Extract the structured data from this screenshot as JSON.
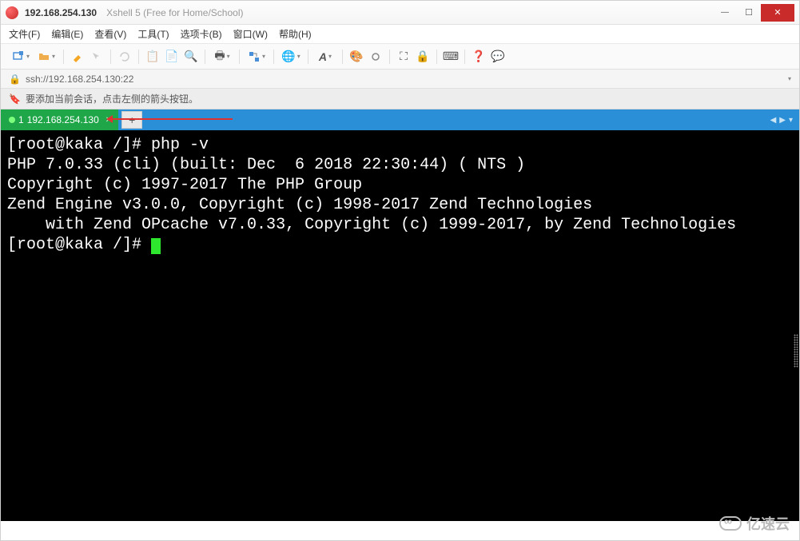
{
  "titlebar": {
    "host": "192.168.254.130",
    "app": "Xshell 5 (Free for Home/School)"
  },
  "menu": {
    "file": "文件(F)",
    "edit": "编辑(E)",
    "view": "查看(V)",
    "tools": "工具(T)",
    "tabs": "选项卡(B)",
    "window": "窗口(W)",
    "help": "帮助(H)"
  },
  "toolbar": {
    "icons": {
      "new": "new-tab-icon",
      "open": "folder-open-icon",
      "highlight": "highlighter-icon",
      "cursor": "arrow-icon",
      "copy": "copy-icon",
      "paste": "paste-icon",
      "search": "search-icon",
      "print": "print-icon",
      "transfer": "file-transfer-icon",
      "globe": "globe-icon",
      "font": "font-icon",
      "color": "palette-icon",
      "session": "session-icon",
      "fullscreen": "fullscreen-icon",
      "lock": "lock-icon",
      "keyboard": "keyboard-icon",
      "help": "help-icon",
      "bubble": "bubble-icon"
    }
  },
  "addressbar": {
    "protocol_icon": "lock-icon",
    "url": "ssh://192.168.254.130:22"
  },
  "msgbar": {
    "icon": "bookmark-icon",
    "text": "要添加当前会话，点击左侧的箭头按钮。"
  },
  "tabs": {
    "active": {
      "index": "1",
      "label": "192.168.254.130"
    },
    "add": "+"
  },
  "terminal": {
    "prompt1": "[root@kaka /]# ",
    "cmd": "php -v",
    "lines": [
      "PHP 7.0.33 (cli) (built: Dec  6 2018 22:30:44) ( NTS )",
      "Copyright (c) 1997-2017 The PHP Group",
      "Zend Engine v3.0.0, Copyright (c) 1998-2017 Zend Technologies",
      "    with Zend OPcache v7.0.33, Copyright (c) 1999-2017, by Zend Technologies"
    ],
    "prompt2": "[root@kaka /]# "
  },
  "watermark": {
    "text": "亿速云"
  }
}
